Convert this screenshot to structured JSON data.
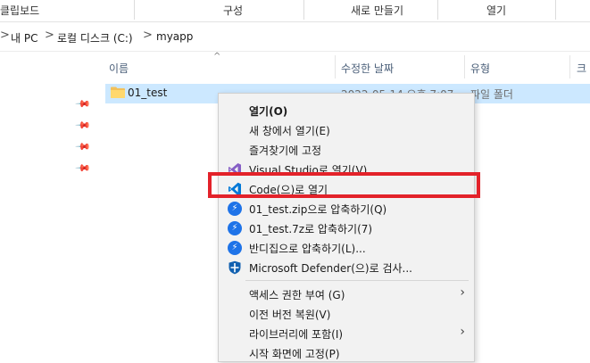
{
  "ribbon": {
    "groups": [
      "클립보드",
      "구성",
      "새로 만들기",
      "열기"
    ]
  },
  "address": {
    "segments": [
      "내 PC",
      "로컬 디스크 (C:)",
      "myapp"
    ],
    "separator": ">"
  },
  "columns": [
    "이름",
    "수정한 날짜",
    "유형",
    "크"
  ],
  "file": {
    "name": "01_test",
    "date": "2022-05-14 오후 7:07",
    "type": "파일 폴더"
  },
  "menu": {
    "items": [
      {
        "label": "열기(O)",
        "icon": "none",
        "bold": true
      },
      {
        "label": "새 창에서 열기(E)",
        "icon": "none"
      },
      {
        "label": "즐겨찾기에 고정",
        "icon": "none"
      },
      {
        "label": "Visual Studio로 열기(V)",
        "icon": "visual-studio-icon"
      },
      {
        "label": "Code(으)로 열기",
        "icon": "vscode-icon"
      },
      {
        "label": "01_test.zip으로 압축하기(Q)",
        "icon": "bandizip-icon"
      },
      {
        "label": "01_test.7z로 압축하기(7)",
        "icon": "bandizip-icon"
      },
      {
        "label": "반디집으로 압축하기(L)...",
        "icon": "bandizip-icon"
      },
      {
        "label": "Microsoft Defender(으)로 검사...",
        "icon": "defender-icon"
      },
      {
        "label": "액세스 권한 부여 (G)",
        "icon": "none",
        "submenu": true
      },
      {
        "label": "이전 버전 복원(V)",
        "icon": "none"
      },
      {
        "label": "라이브러리에 포함(I)",
        "icon": "none",
        "submenu": true
      },
      {
        "label": "시작 화면에 고정(P)",
        "icon": "none"
      }
    ]
  },
  "colors": {
    "selection": "#cce8ff",
    "highlight_box": "#e3222a",
    "vs_purple": "#865fc5",
    "vscode_blue": "#0078d7",
    "bandizip_blue": "#1e73e8"
  }
}
